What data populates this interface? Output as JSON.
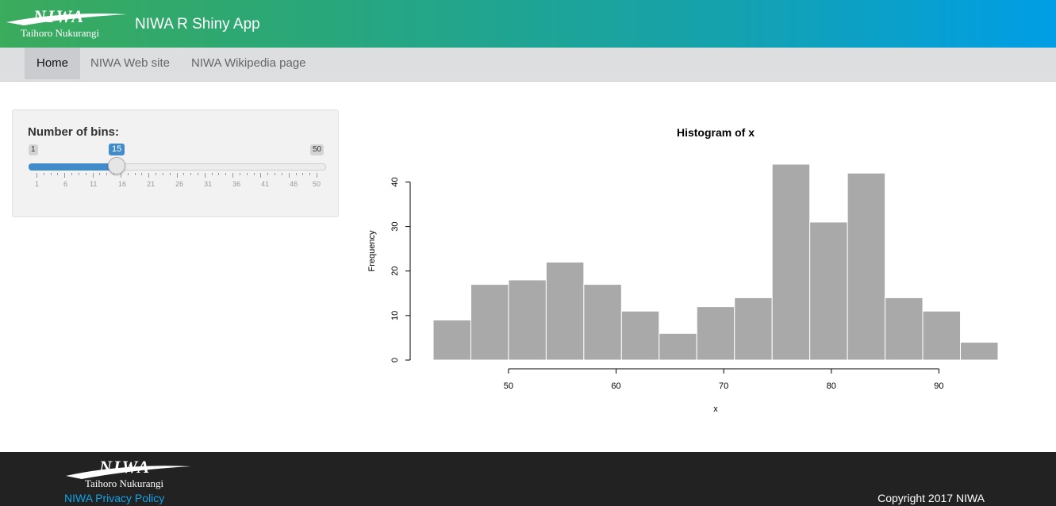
{
  "header": {
    "logo_text": "NIWA",
    "logo_subtext": "Taihoro Nukurangi",
    "app_title": "NIWA R Shiny App"
  },
  "nav": {
    "items": [
      {
        "label": "Home",
        "active": true
      },
      {
        "label": "NIWA Web site",
        "active": false
      },
      {
        "label": "NIWA Wikipedia page",
        "active": false
      }
    ]
  },
  "slider": {
    "label": "Number of bins:",
    "min": 1,
    "max": 50,
    "value": 15,
    "tick_labels": [
      "1",
      "6",
      "11",
      "16",
      "21",
      "26",
      "31",
      "36",
      "41",
      "46",
      "50"
    ],
    "accent_color": "#428bca"
  },
  "chart_data": {
    "type": "bar",
    "title": "Histogram of x",
    "xlabel": "x",
    "ylabel": "Frequency",
    "bin_edges": [
      43,
      46.5,
      50,
      53.5,
      57,
      60.5,
      64,
      67.5,
      71,
      74.5,
      78,
      81.5,
      85,
      88.5,
      92,
      95.5
    ],
    "values": [
      9,
      17,
      18,
      22,
      17,
      11,
      6,
      12,
      14,
      44,
      31,
      42,
      14,
      11,
      4
    ],
    "xticks": [
      50,
      60,
      70,
      80,
      90
    ],
    "yticks": [
      0,
      10,
      20,
      30,
      40
    ],
    "xlim": [
      43,
      95.5
    ],
    "ylim": [
      0,
      44
    ],
    "bar_color": "#a9a9a9",
    "grid": false
  },
  "footer": {
    "logo_text": "NIWA",
    "logo_subtext": "Taihoro Nukurangi",
    "privacy_link": "NIWA Privacy Policy",
    "copyright": "Copyright 2017 NIWA"
  }
}
